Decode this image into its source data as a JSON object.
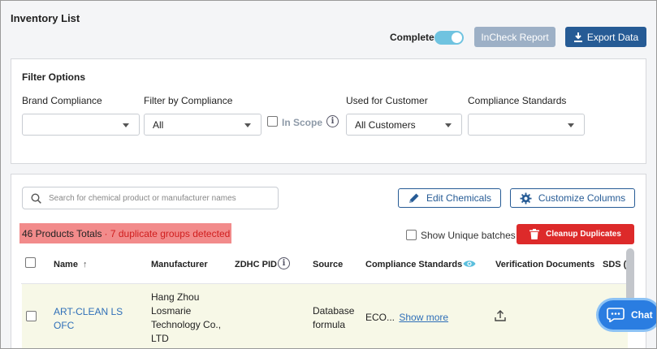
{
  "page": {
    "title": "Inventory List"
  },
  "toolbar": {
    "complete_label": "Complete",
    "complete_on": true,
    "incheck_label": "InCheck Report",
    "export_label": "Export Data"
  },
  "filters": {
    "heading": "Filter Options",
    "brand_compliance": {
      "label": "Brand Compliance",
      "value": ""
    },
    "filter_compliance": {
      "label": "Filter by Compliance",
      "value": "All"
    },
    "in_scope": {
      "label": "In Scope",
      "checked": false
    },
    "customer": {
      "label": "Used for Customer",
      "value": "All Customers"
    },
    "standards": {
      "label": "Compliance Standards",
      "value": ""
    }
  },
  "list": {
    "search_placeholder": "Search for chemical product or manufacturer names",
    "edit_chemicals_label": "Edit Chemicals",
    "customize_columns_label": "Customize Columns",
    "totals_text": "46 Products Totals",
    "duplicates_text": "· 7 duplicate groups detected",
    "show_unique_label": "Show Unique batches",
    "cleanup_label": "Cleanup Duplicates",
    "columns": {
      "name": "Name",
      "manufacturer": "Manufacturer",
      "zdhc": "ZDHC PID",
      "source": "Source",
      "compliance": "Compliance Standards",
      "verification": "Verification Documents",
      "sds": "SDS ("
    },
    "rows": [
      {
        "name": "ART-CLEAN LS OFC",
        "manufacturer": "Hang Zhou Losmarie Technology Co., LTD",
        "zdhc_pid": "",
        "source": "Database formula",
        "compliance": "ECO...",
        "show_more": "Show more"
      }
    ]
  },
  "chat": {
    "label": "Chat"
  },
  "colors": {
    "primary": "#265b95",
    "link": "#2f6fb8",
    "danger": "#dd2a2a",
    "toggle_on": "#6fc3e0",
    "chat": "#2a7de1"
  }
}
